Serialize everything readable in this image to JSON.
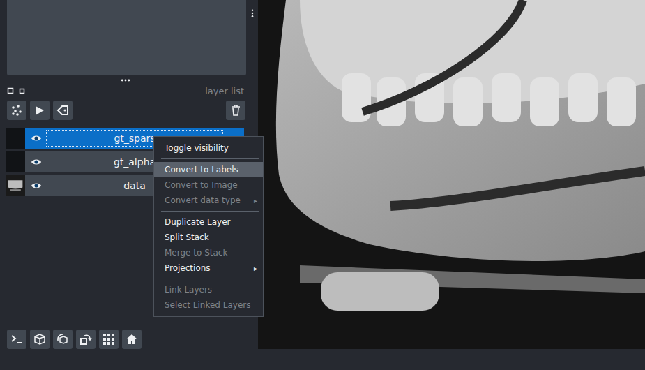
{
  "layer_panel": {
    "section_label": "layer list"
  },
  "layers": [
    {
      "name": "gt_spars",
      "visible": true,
      "selected": true,
      "editing": true,
      "thumbnail": "blank"
    },
    {
      "name": "gt_alpha",
      "visible": true,
      "selected": false,
      "editing": false,
      "thumbnail": "blank"
    },
    {
      "name": "data",
      "visible": true,
      "selected": false,
      "editing": false,
      "thumbnail": "image"
    }
  ],
  "context_menu": {
    "items": [
      {
        "kind": "item",
        "label": "Toggle visibility",
        "disabled": false,
        "selected": false,
        "submenu": ""
      },
      {
        "kind": "separator"
      },
      {
        "kind": "item",
        "label": "Convert to Labels",
        "disabled": false,
        "selected": true,
        "submenu": ""
      },
      {
        "kind": "item",
        "label": "Convert to Image",
        "disabled": true,
        "selected": false,
        "submenu": ""
      },
      {
        "kind": "item",
        "label": "Convert data type",
        "disabled": true,
        "selected": false,
        "submenu": "▸"
      },
      {
        "kind": "separator"
      },
      {
        "kind": "item",
        "label": "Duplicate Layer",
        "disabled": false,
        "selected": false,
        "submenu": ""
      },
      {
        "kind": "item",
        "label": "Split Stack",
        "disabled": false,
        "selected": false,
        "submenu": ""
      },
      {
        "kind": "item",
        "label": "Merge to Stack",
        "disabled": true,
        "selected": false,
        "submenu": ""
      },
      {
        "kind": "item",
        "label": "Projections",
        "disabled": false,
        "selected": false,
        "submenu": "▸"
      },
      {
        "kind": "separator"
      },
      {
        "kind": "item",
        "label": "Link Layers",
        "disabled": true,
        "selected": false,
        "submenu": ""
      },
      {
        "kind": "item",
        "label": "Select Linked Layers",
        "disabled": true,
        "selected": false,
        "submenu": ""
      }
    ]
  }
}
